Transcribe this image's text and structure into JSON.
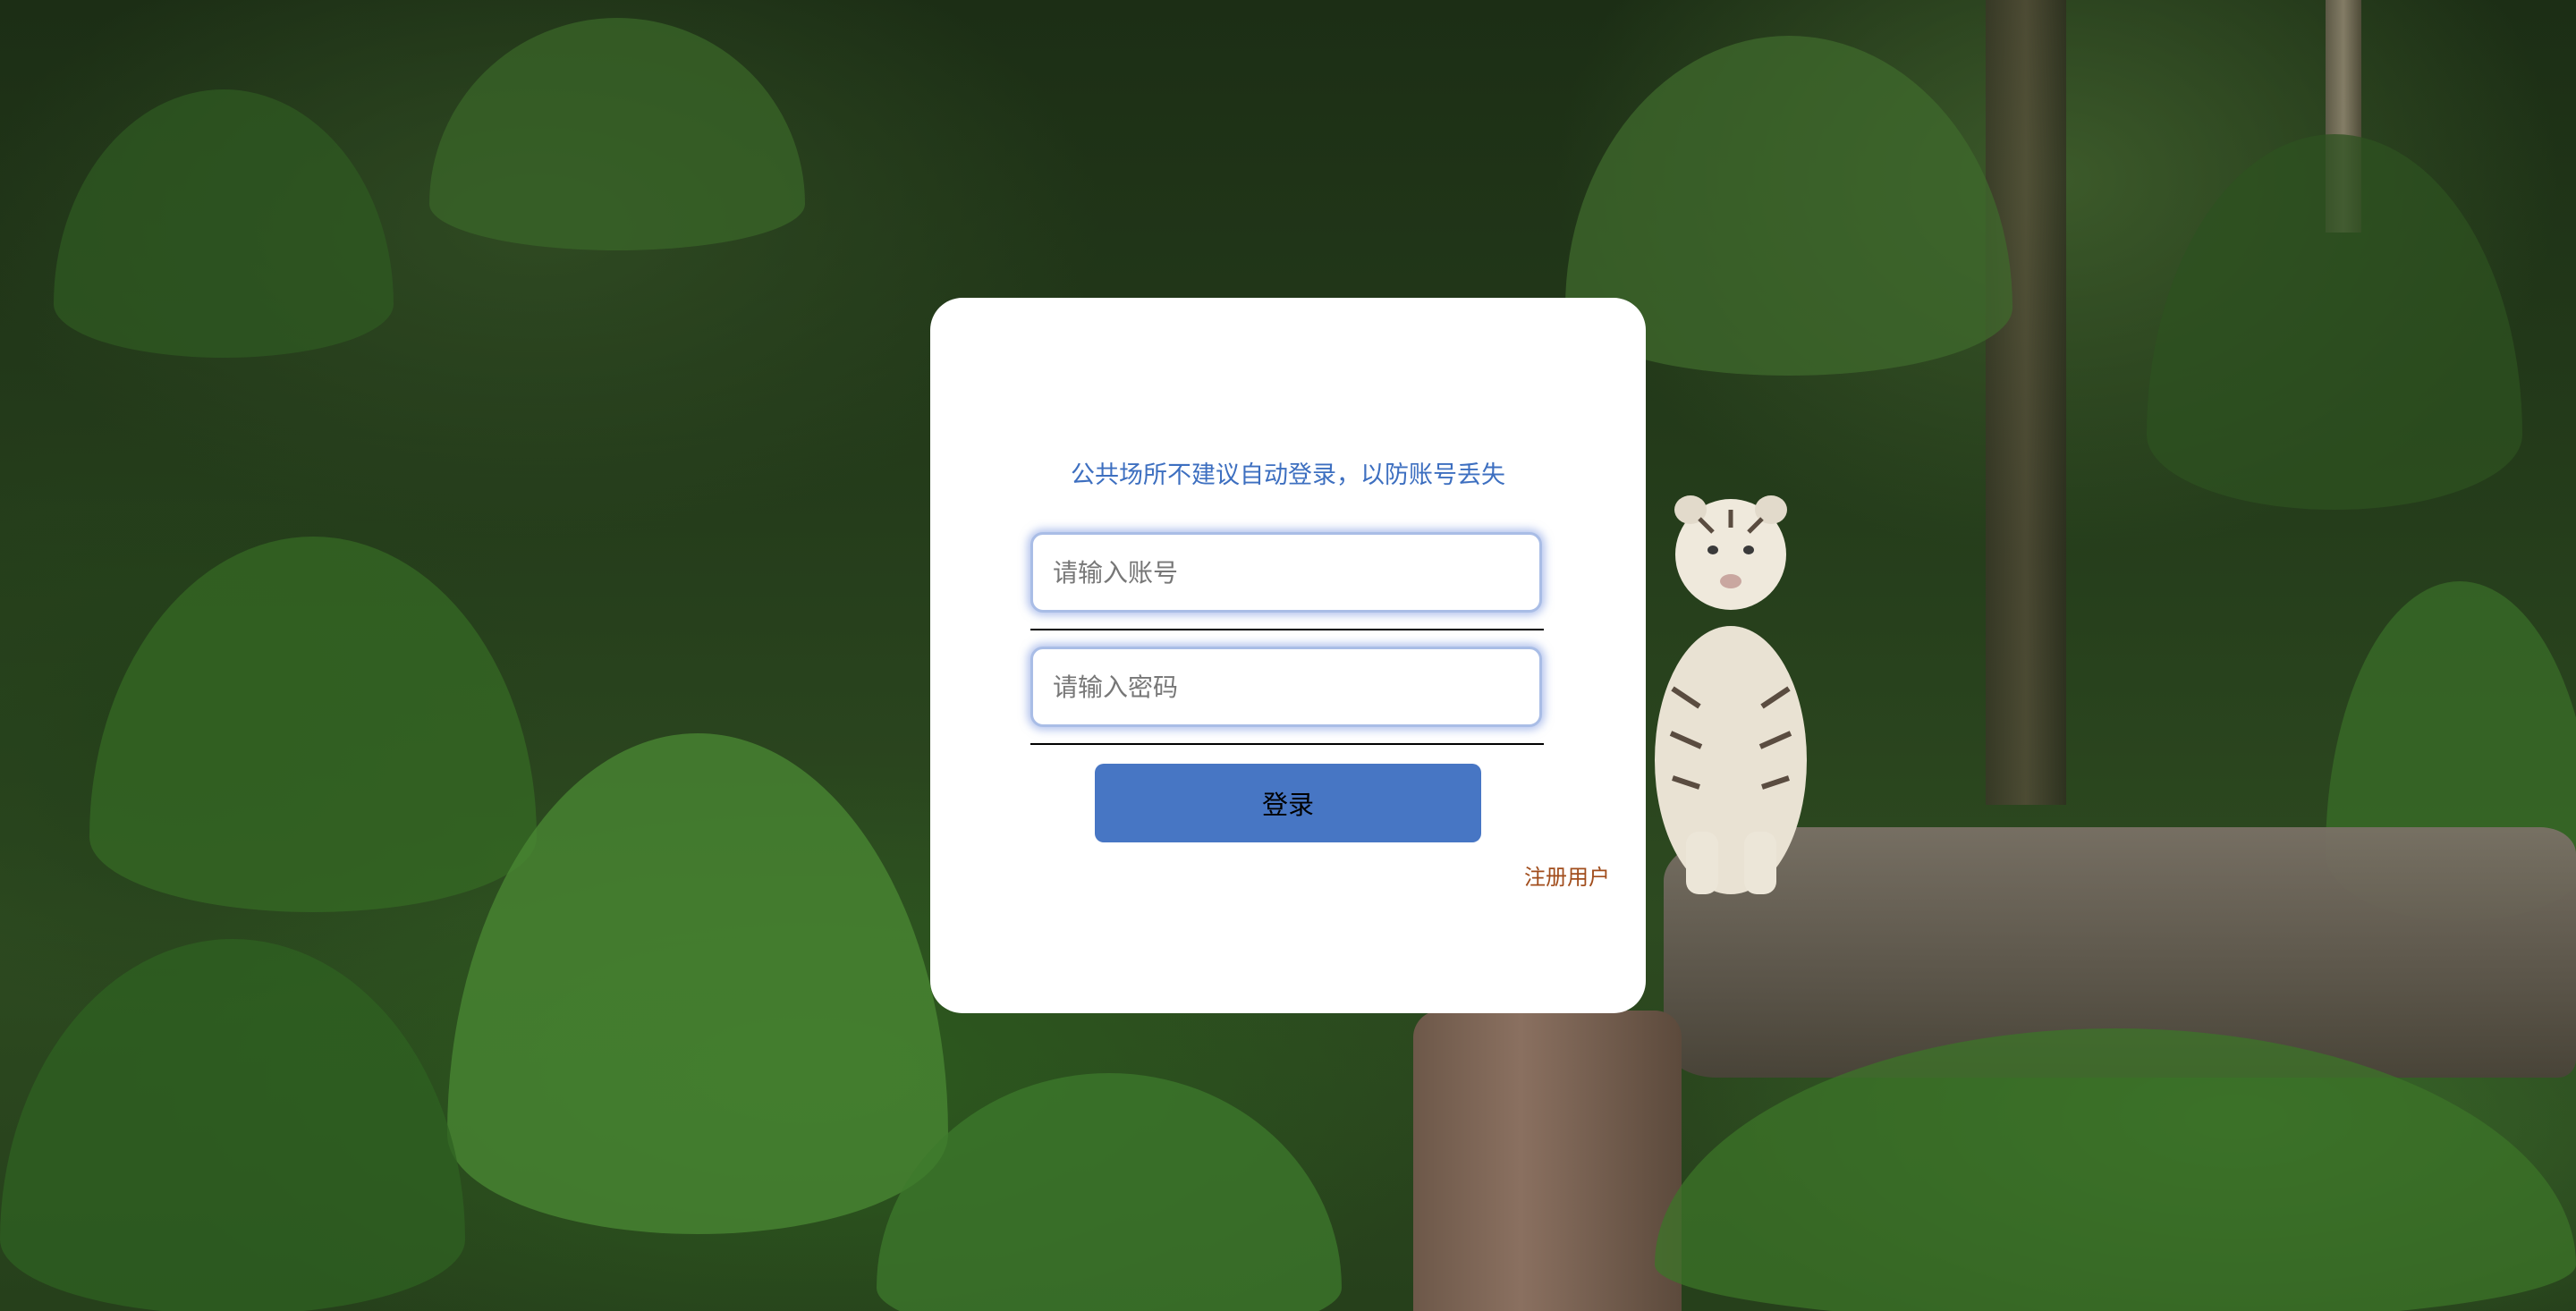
{
  "login": {
    "notice": "公共场所不建议自动登录，以防账号丢失",
    "username_placeholder": "请输入账号",
    "password_placeholder": "请输入密码",
    "login_button": "登录",
    "register_link": "注册用户"
  },
  "colors": {
    "notice_text": "#3d6fc0",
    "button_bg": "#4776c4",
    "register_text": "#a14d1c",
    "card_bg": "#ffffff"
  }
}
